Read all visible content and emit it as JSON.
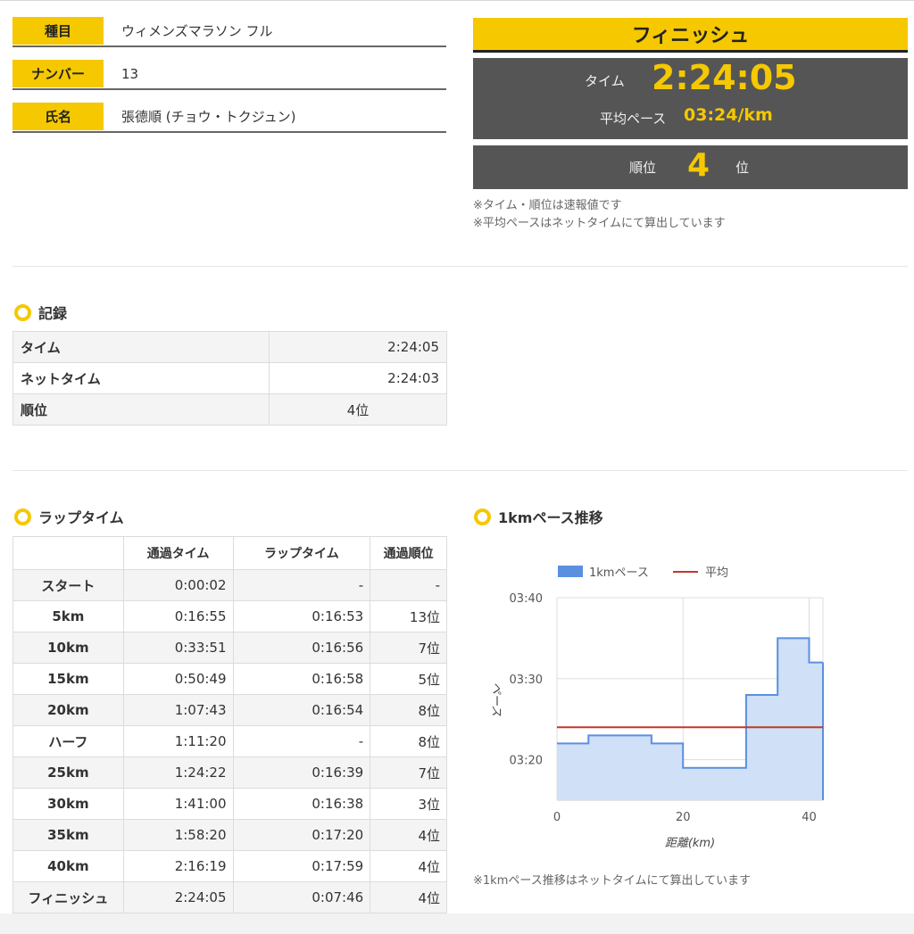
{
  "entry": {
    "event_label": "種目",
    "event_value": "ウィメンズマラソン フル",
    "number_label": "ナンバー",
    "number_value": "13",
    "name_label": "氏名",
    "name_value": "張德順 (チョウ・トクジュン)"
  },
  "finish": {
    "title": "フィニッシュ",
    "time_label": "タイム",
    "time_value": "2:24:05",
    "pace_label": "平均ペース",
    "pace_value": "03:24/km",
    "rank_label": "順位",
    "rank_value": "4",
    "rank_suffix": "位",
    "note1": "※タイム・順位は速報値です",
    "note2": "※平均ペースはネットタイムにて算出しています"
  },
  "record": {
    "title": "記録",
    "rows": [
      {
        "label": "タイム",
        "value": "2:24:05"
      },
      {
        "label": "ネットタイム",
        "value": "2:24:03"
      },
      {
        "label": "順位",
        "value": "4位"
      }
    ]
  },
  "laps": {
    "title": "ラップタイム",
    "headers": [
      "",
      "通過タイム",
      "ラップタイム",
      "通過順位"
    ],
    "rows": [
      {
        "point": "スタート",
        "pass": "0:00:02",
        "lap": "-",
        "rank": "-"
      },
      {
        "point": "5km",
        "pass": "0:16:55",
        "lap": "0:16:53",
        "rank": "13位"
      },
      {
        "point": "10km",
        "pass": "0:33:51",
        "lap": "0:16:56",
        "rank": "7位"
      },
      {
        "point": "15km",
        "pass": "0:50:49",
        "lap": "0:16:58",
        "rank": "5位"
      },
      {
        "point": "20km",
        "pass": "1:07:43",
        "lap": "0:16:54",
        "rank": "8位"
      },
      {
        "point": "ハーフ",
        "pass": "1:11:20",
        "lap": "-",
        "rank": "8位"
      },
      {
        "point": "25km",
        "pass": "1:24:22",
        "lap": "0:16:39",
        "rank": "7位"
      },
      {
        "point": "30km",
        "pass": "1:41:00",
        "lap": "0:16:38",
        "rank": "3位"
      },
      {
        "point": "35km",
        "pass": "1:58:20",
        "lap": "0:17:20",
        "rank": "4位"
      },
      {
        "point": "40km",
        "pass": "2:16:19",
        "lap": "0:17:59",
        "rank": "4位"
      },
      {
        "point": "フィニッシュ",
        "pass": "2:24:05",
        "lap": "0:07:46",
        "rank": "4位"
      }
    ]
  },
  "pace_section": {
    "title": "1kmペース推移",
    "note": "※1kmペース推移はネットタイムにて算出しています"
  },
  "chart_data": {
    "type": "area",
    "xlabel": "距離(km)",
    "ylabel": "ペース",
    "xlim": [
      0,
      42.195
    ],
    "ylim": [
      "03:15",
      "03:40"
    ],
    "x_ticks": [
      "0",
      "20",
      "40"
    ],
    "y_ticks": [
      "03:20",
      "03:30",
      "03:40"
    ],
    "legend": [
      "1kmペース",
      "平均"
    ],
    "legend_position": "top",
    "grid": true,
    "series": [
      {
        "name": "1kmペース",
        "color": "#5b8fe0",
        "step_start_km": [
          0,
          5,
          15,
          20,
          30,
          35,
          40
        ],
        "pace": [
          "03:22",
          "03:23",
          "03:22",
          "03:19",
          "03:28",
          "03:35",
          "03:32"
        ],
        "end_km": 42.195
      },
      {
        "name": "平均",
        "color": "#c0392b",
        "value": "03:24"
      }
    ]
  }
}
